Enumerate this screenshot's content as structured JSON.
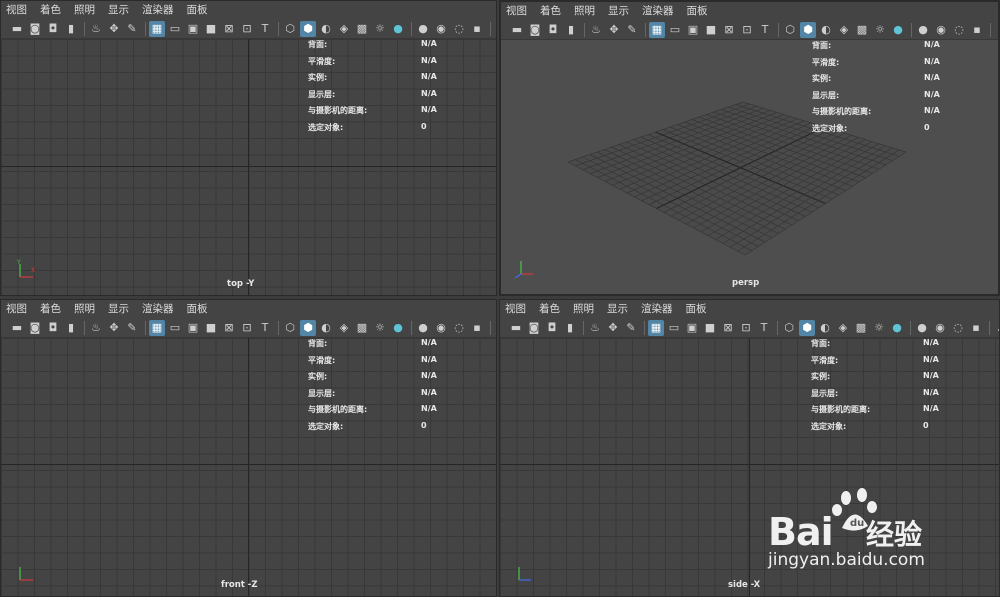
{
  "menu": [
    "视图",
    "着色",
    "照明",
    "显示",
    "渲染器",
    "面板"
  ],
  "toolbar_icons": [
    "camera-icon",
    "camera-attr-icon",
    "bookmark-camera-icon",
    "bookmark-icon",
    "image-plane-icon",
    "2d-pan-icon",
    "grease-pencil-icon",
    "grid-icon",
    "film-gate-icon",
    "resolution-gate-icon",
    "gate-mask-icon",
    "field-chart-icon",
    "safe-action-icon",
    "safe-title-icon",
    "wireframe-icon",
    "smooth-shade-icon",
    "default-light-icon",
    "shadows-icon",
    "texture-icon",
    "lights-icon",
    "ambient-occlusion-icon",
    "motion-blur-icon",
    "anti-alias-icon",
    "depth-of-field-icon",
    "isolate-select-icon",
    "xray-icon",
    "select-camera-icon",
    "lock-camera-icon"
  ],
  "hud_rows": [
    {
      "label": "背面:",
      "value": "N/A"
    },
    {
      "label": "平滑度:",
      "value": "N/A"
    },
    {
      "label": "实例:",
      "value": "N/A"
    },
    {
      "label": "显示层:",
      "value": "N/A"
    },
    {
      "label": "与摄影机的距离:",
      "value": "N/A"
    },
    {
      "label": "选定对象:",
      "value": "0"
    }
  ],
  "viewports": {
    "top": {
      "label": "top -Y"
    },
    "persp": {
      "label": "persp"
    },
    "front": {
      "label": "front -Z"
    },
    "side": {
      "label": "side -X"
    }
  },
  "watermark": {
    "brand": "Bai",
    "brand2": "经验",
    "url": "jingyan.baidu.com"
  },
  "colors": {
    "accent": "#5285a6",
    "axis_x": "#d13a3a",
    "axis_y": "#4cc24c",
    "axis_z": "#3d6cf0"
  }
}
